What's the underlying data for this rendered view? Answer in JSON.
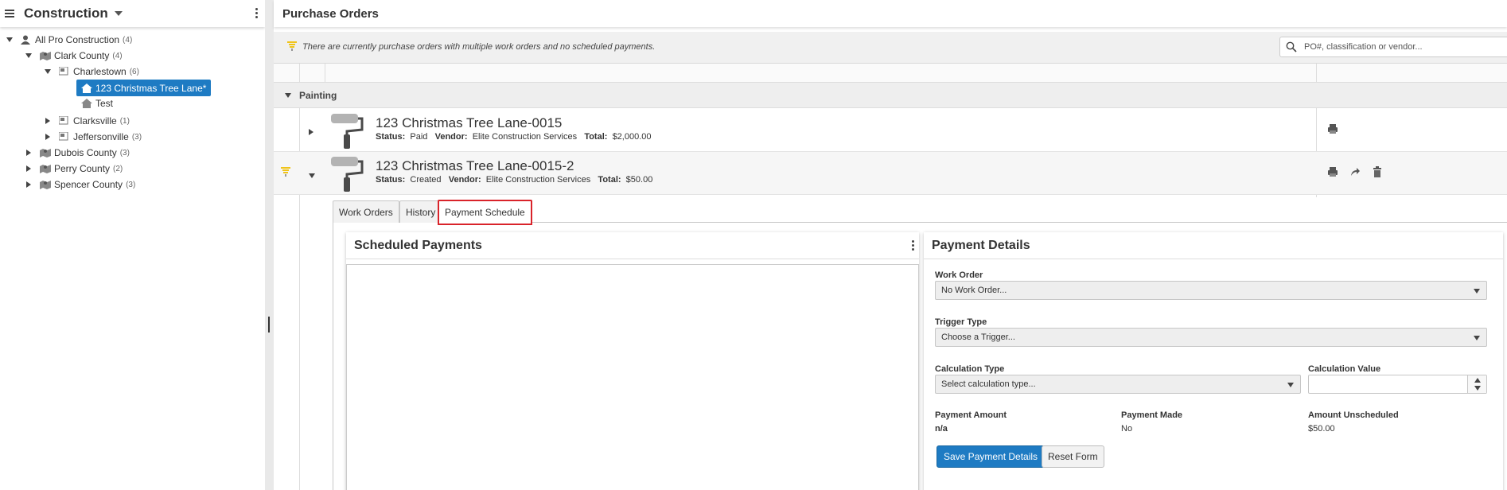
{
  "sidebar": {
    "title": "Construction",
    "tree": [
      {
        "label": "All Pro Construction",
        "count": "(4)"
      },
      {
        "label": "Clark County",
        "count": "(4)"
      },
      {
        "label": "Charlestown",
        "count": "(6)"
      },
      {
        "label": "123 Christmas Tree Lane*",
        "count": ""
      },
      {
        "label": "Test",
        "count": ""
      },
      {
        "label": "Clarksville",
        "count": "(1)"
      },
      {
        "label": "Jeffersonville",
        "count": "(3)"
      },
      {
        "label": "Dubois County",
        "count": "(3)"
      },
      {
        "label": "Perry County",
        "count": "(2)"
      },
      {
        "label": "Spencer County",
        "count": "(3)"
      }
    ]
  },
  "main": {
    "title": "Purchase Orders",
    "notice": "There are currently purchase orders with multiple work orders and no scheduled payments.",
    "search": {
      "placeholder": "PO#, classification or vendor...",
      "value": ""
    },
    "group": "Painting",
    "orders": [
      {
        "name": "123 Christmas Tree Lane-0015",
        "status_label": "Status:",
        "status": "Paid",
        "vendor_label": "Vendor:",
        "vendor": "Elite Construction Services",
        "total_label": "Total:",
        "total": "$2,000.00"
      },
      {
        "name": "123 Christmas Tree Lane-0015-2",
        "status_label": "Status:",
        "status": "Created",
        "vendor_label": "Vendor:",
        "vendor": "Elite Construction Services",
        "total_label": "Total:",
        "total": "$50.00"
      }
    ],
    "tabs": [
      "Work Orders",
      "History",
      "Payment Schedule"
    ],
    "active_tab": "Payment Schedule"
  },
  "scheduled_payments": {
    "title": "Scheduled Payments"
  },
  "payment_details": {
    "title": "Payment Details",
    "work_order_label": "Work Order",
    "work_order_value": "No Work Order...",
    "trigger_label": "Trigger Type",
    "trigger_value": "Choose a Trigger...",
    "calc_type_label": "Calculation Type",
    "calc_type_value": "Select calculation type...",
    "calc_value_label": "Calculation Value",
    "calc_value": "",
    "payment_amount_label": "Payment Amount",
    "payment_amount": "n/a",
    "payment_made_label": "Payment Made",
    "payment_made": "No",
    "amount_unscheduled_label": "Amount Unscheduled",
    "amount_unscheduled": "$50.00",
    "save_label": "Save Payment Details",
    "reset_label": "Reset Form"
  },
  "colors": {
    "accent": "#1e7bc3",
    "highlight": "#d9232a",
    "notice_icon": "#f0c419"
  }
}
